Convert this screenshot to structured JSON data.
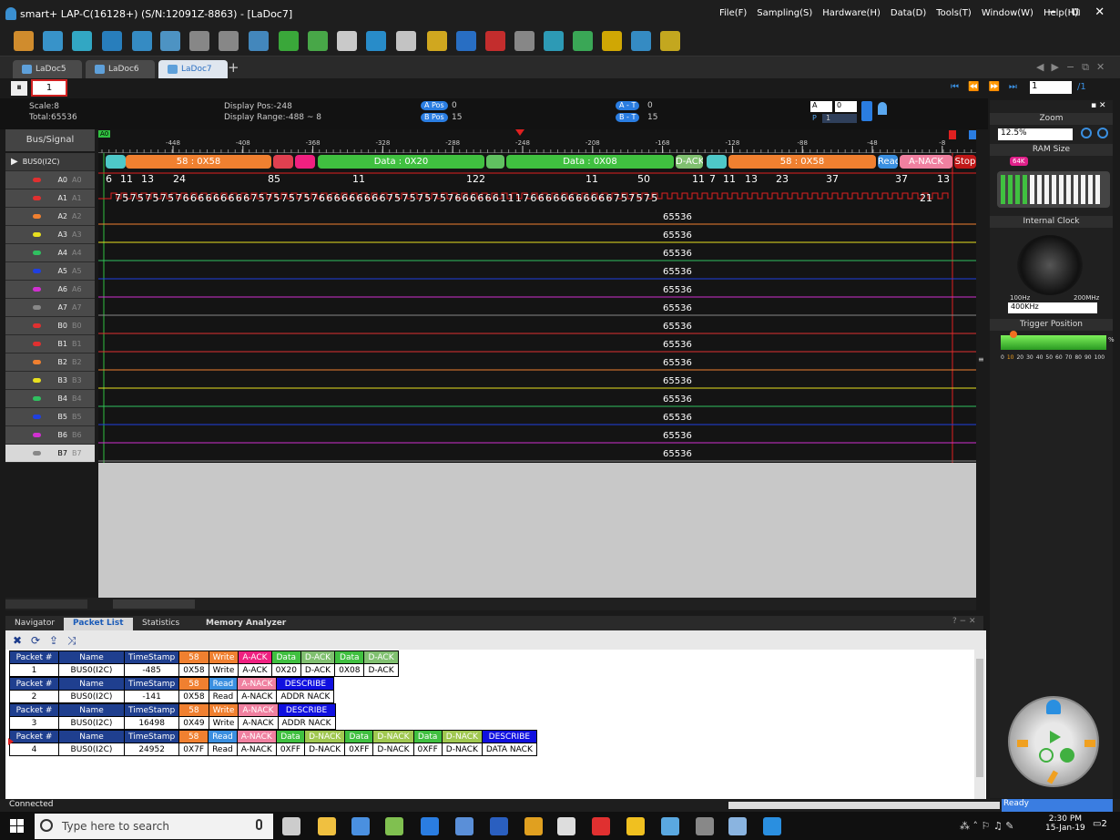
{
  "window": {
    "title": "smart+  LAP-C(16128+) (S/N:12091Z-8863) - [LaDoc7]",
    "controls": [
      "−",
      "⧉",
      "✕"
    ]
  },
  "menu": [
    "File(F)",
    "Sampling(S)",
    "Hardware(H)",
    "Data(D)",
    "Tools(T)",
    "Window(W)",
    "Help(H)"
  ],
  "toolbar": {
    "icons": [
      "open-icon",
      "save-icon",
      "save-as-icon",
      "export-icon",
      "camera-icon",
      "tools-icon",
      "probe-icon",
      "database-icon",
      "grid-icon",
      "layout-icon",
      "arrow-icon",
      "book-icon",
      "bus-icon",
      "film-icon",
      "flag-yellow-icon",
      "flag-blue-icon",
      "flag-red-icon",
      "trash-icon",
      "search-icon",
      "search-green-icon",
      "star-icon",
      "calculator-icon",
      "refresh-icon"
    ],
    "colors": [
      "#f0a030",
      "#3da8e8",
      "#36c0e0",
      "#2a8fd8",
      "#3a9fe0",
      "#56a8e0",
      "#9a9a9a",
      "#9a9a9a",
      "#4a9ad8",
      "#40c040",
      "#50c050",
      "#e8e8e8",
      "#2aa0e8",
      "#e0e0e0",
      "#f0c020",
      "#2a7de1",
      "#e03030",
      "#9a9a9a",
      "#30b0d0",
      "#40c060",
      "#f0c000",
      "#3a9fe0",
      "#e0c020"
    ]
  },
  "tabs": [
    {
      "label": "LaDoc5"
    },
    {
      "label": "LaDoc6"
    },
    {
      "label": "LaDoc7"
    }
  ],
  "tab_add": "+",
  "tab_right": [
    "◀",
    "▶",
    "−",
    "⧉",
    "✕"
  ],
  "control": {
    "page_input": "1",
    "nav": [
      "⏮",
      "⏪",
      "⏩",
      "⏭"
    ],
    "goto": "1",
    "goto_total": "/1"
  },
  "info": {
    "scale": "Scale:8",
    "total": "Total:65536",
    "display_pos": "Display Pos:-248",
    "display_range": "Display Range:-488 ~ 8",
    "a_pos_label": "A Pos",
    "a_pos": "0",
    "b_pos_label": "B Pos",
    "b_pos": "15",
    "a_t_label": "A - T",
    "a_t": "0",
    "b_t_label": "B - T",
    "b_t": "15",
    "sel_a": "A",
    "sel_num": "0",
    "p_label": "P",
    "p_val": "1"
  },
  "signals": {
    "header": "Bus/Signal",
    "bus": "BUS0(I2C)",
    "rows": [
      {
        "name": "A0",
        "dim": "A0",
        "color": "#e03030"
      },
      {
        "name": "A1",
        "dim": "A1",
        "color": "#e03030"
      },
      {
        "name": "A2",
        "dim": "A2",
        "color": "#f08030"
      },
      {
        "name": "A3",
        "dim": "A3",
        "color": "#e8e020"
      },
      {
        "name": "A4",
        "dim": "A4",
        "color": "#30c060"
      },
      {
        "name": "A5",
        "dim": "A5",
        "color": "#2040e0"
      },
      {
        "name": "A6",
        "dim": "A6",
        "color": "#d030d0"
      },
      {
        "name": "A7",
        "dim": "A7",
        "color": "#888888"
      },
      {
        "name": "B0",
        "dim": "B0",
        "color": "#e03030"
      },
      {
        "name": "B1",
        "dim": "B1",
        "color": "#e03030"
      },
      {
        "name": "B2",
        "dim": "B2",
        "color": "#f08030"
      },
      {
        "name": "B3",
        "dim": "B3",
        "color": "#e8e020"
      },
      {
        "name": "B4",
        "dim": "B4",
        "color": "#30c060"
      },
      {
        "name": "B5",
        "dim": "B5",
        "color": "#2040e0"
      },
      {
        "name": "B6",
        "dim": "B6",
        "color": "#d030d0"
      },
      {
        "name": "B7",
        "dim": "B7",
        "color": "#888888"
      }
    ]
  },
  "ruler": {
    "labels": [
      "-448",
      "-408",
      "-368",
      "-328",
      "-288",
      "-248",
      "-208",
      "-168",
      "-128",
      "-88",
      "-48",
      "-8"
    ],
    "marker_a": "A0"
  },
  "bus_segments": [
    {
      "text": "",
      "color": "#4ec8c8"
    },
    {
      "text": "58 : 0X58",
      "color": "#f08030"
    },
    {
      "text": "",
      "color": "#e04050"
    },
    {
      "text": "",
      "color": "#f02080"
    },
    {
      "text": "Data : 0X20",
      "color": "#40c040"
    },
    {
      "text": "",
      "color": "#60c060"
    },
    {
      "text": "Data : 0X08",
      "color": "#40c040"
    },
    {
      "text": "D-ACK",
      "color": "#80c070"
    },
    {
      "text": "",
      "color": "#4ec8c8"
    },
    {
      "text": "58 : 0X58",
      "color": "#f08030"
    },
    {
      "text": "Read",
      "color": "#3a8fe0"
    },
    {
      "text": "A-NACK",
      "color": "#f080a0"
    },
    {
      "text": "Stop",
      "color": "#c01818"
    }
  ],
  "a0_counts": [
    "6",
    "11",
    "13",
    "24",
    "85",
    "11",
    "122",
    "11",
    "50",
    "11",
    "7",
    "11",
    "13",
    "23",
    "37",
    "37",
    "13"
  ],
  "a1_digits": "757575757666666666757575757666666666757575757666666111766666666666757575",
  "a1_tail": "21",
  "count_value": "65536",
  "right": {
    "zoom_label": "Zoom",
    "zoom_value": "12.5%",
    "ram_label": "RAM Size",
    "ram_badge": "64K",
    "clock_label": "Internal Clock",
    "clock_min": "100Hz",
    "clock_max": "200MHz",
    "clock_value": "400KHz",
    "trigger_label": "Trigger Position",
    "trigger_pct": "%",
    "trigger_scale": [
      "0",
      "10",
      "20",
      "30",
      "40",
      "50",
      "60",
      "70",
      "80",
      "90",
      "100"
    ],
    "trigger_selected": "10"
  },
  "bottom_tabs": [
    {
      "label": "Navigator"
    },
    {
      "label": "Packet List"
    },
    {
      "label": "Statistics"
    },
    {
      "label": "Memory Analyzer"
    }
  ],
  "bottom_controls": "? − ✕",
  "packets": [
    {
      "headers": [
        [
          "Packet #",
          "#1f3f8f"
        ],
        [
          "Name",
          "#1f3f8f"
        ],
        [
          "TimeStamp",
          "#1f3f8f"
        ],
        [
          "58",
          "#f08030"
        ],
        [
          "Write",
          "#f08030"
        ],
        [
          "A-ACK",
          "#f02080"
        ],
        [
          "Data",
          "#40c040"
        ],
        [
          "D-ACK",
          "#80c070"
        ],
        [
          "Data",
          "#40c040"
        ],
        [
          "D-ACK",
          "#80c070"
        ]
      ],
      "values": [
        "1",
        "BUS0(I2C)",
        "-485",
        "0X58",
        "Write",
        "A-ACK",
        "0X20",
        "D-ACK",
        "0X08",
        "D-ACK"
      ]
    },
    {
      "headers": [
        [
          "Packet #",
          "#1f3f8f"
        ],
        [
          "Name",
          "#1f3f8f"
        ],
        [
          "TimeStamp",
          "#1f3f8f"
        ],
        [
          "58",
          "#f08030"
        ],
        [
          "Read",
          "#3a8fe0"
        ],
        [
          "A-NACK",
          "#f080a0"
        ],
        [
          "DESCRIBE",
          "#1010e0"
        ]
      ],
      "values": [
        "2",
        "BUS0(I2C)",
        "-141",
        "0X58",
        "Read",
        "A-NACK",
        "ADDR NACK"
      ]
    },
    {
      "headers": [
        [
          "Packet #",
          "#1f3f8f"
        ],
        [
          "Name",
          "#1f3f8f"
        ],
        [
          "TimeStamp",
          "#1f3f8f"
        ],
        [
          "58",
          "#f08030"
        ],
        [
          "Write",
          "#f08030"
        ],
        [
          "A-NACK",
          "#f080a0"
        ],
        [
          "DESCRIBE",
          "#1010e0"
        ]
      ],
      "values": [
        "3",
        "BUS0(I2C)",
        "16498",
        "0X49",
        "Write",
        "A-NACK",
        "ADDR NACK"
      ]
    },
    {
      "headers": [
        [
          "Packet #",
          "#1f3f8f"
        ],
        [
          "Name",
          "#1f3f8f"
        ],
        [
          "TimeStamp",
          "#1f3f8f"
        ],
        [
          "58",
          "#f08030"
        ],
        [
          "Read",
          "#3a8fe0"
        ],
        [
          "A-NACK",
          "#f080a0"
        ],
        [
          "Data",
          "#40c040"
        ],
        [
          "D-NACK",
          "#a0c850"
        ],
        [
          "Data",
          "#40c040"
        ],
        [
          "D-NACK",
          "#a0c850"
        ],
        [
          "Data",
          "#40c040"
        ],
        [
          "D-NACK",
          "#a0c850"
        ],
        [
          "DESCRIBE",
          "#1010e0"
        ]
      ],
      "values": [
        "4",
        "BUS0(I2C)",
        "24952",
        "0X7F",
        "Read",
        "A-NACK",
        "0XFF",
        "D-NACK",
        "0XFF",
        "D-NACK",
        "0XFF",
        "D-NACK",
        "DATA NACK"
      ]
    }
  ],
  "status": {
    "left": "Connected",
    "right": "Ready"
  },
  "taskbar": {
    "search_placeholder": "Type here to search",
    "time": "2:30 PM",
    "date": "15-Jan-19",
    "notif_count": "2",
    "icons": [
      "task-view-icon",
      "file-explorer-icon",
      "store-icon",
      "notepad-icon",
      "edge-icon",
      "network-icon",
      "powershell-icon",
      "chrome-icon",
      "7zip-icon",
      "pdf-icon",
      "puzzle-icon",
      "smart-app-icon",
      "calculator-icon",
      "sticky-icon",
      "camera-app-icon"
    ],
    "icon_colors": [
      "#ccc",
      "#f0c040",
      "#4a90e0",
      "#80c050",
      "#2a7de1",
      "#5a8fd8",
      "#2a5fc0",
      "#e0a020",
      "#ddd",
      "#e03030",
      "#f0c020",
      "#5aa8e0",
      "#888",
      "#8ab4e0",
      "#2a8fe0"
    ]
  }
}
